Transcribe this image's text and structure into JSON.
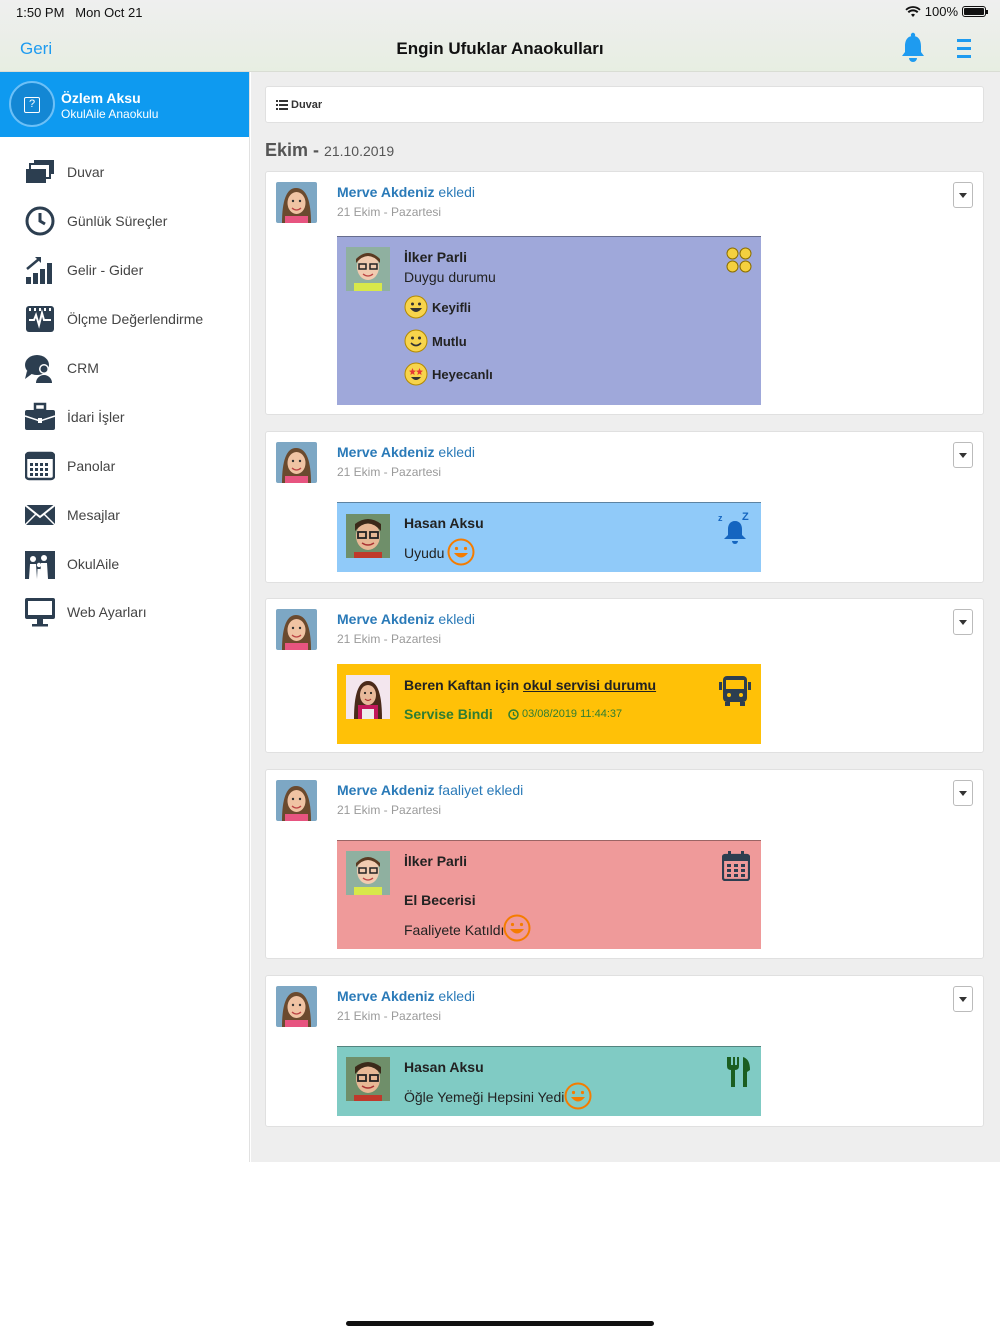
{
  "status_bar": {
    "time": "1:50 PM",
    "date": "Mon Oct 21",
    "battery": "100%"
  },
  "header": {
    "back_label": "Geri",
    "title": "Engin Ufuklar Anaokulları"
  },
  "profile": {
    "name": "Özlem Aksu",
    "school": "OkulAile Anaokulu"
  },
  "sidebar": {
    "items": [
      {
        "label": "Duvar",
        "icon": "wall-icon"
      },
      {
        "label": "Günlük Süreçler",
        "icon": "clock-icon"
      },
      {
        "label": "Gelir - Gider",
        "icon": "chart-icon"
      },
      {
        "label": "Ölçme Değerlendirme",
        "icon": "pulse-icon"
      },
      {
        "label": "CRM",
        "icon": "crm-icon"
      },
      {
        "label": "İdari İşler",
        "icon": "briefcase-icon"
      },
      {
        "label": "Panolar",
        "icon": "board-icon"
      },
      {
        "label": "Mesajlar",
        "icon": "envelope-icon"
      },
      {
        "label": "OkulAile",
        "icon": "family-icon"
      },
      {
        "label": "Web Ayarları",
        "icon": "monitor-icon"
      }
    ]
  },
  "breadcrumb": {
    "label": "Duvar"
  },
  "date_header": {
    "month": "Ekim",
    "sep": " - ",
    "date": "21.10.2019"
  },
  "posts": [
    {
      "author": "Merve Akdeniz",
      "action": " ekledi",
      "date": "21 Ekim - Pazartesi",
      "child": "İlker Parli",
      "subtitle": "Duygu durumu",
      "moods": [
        "Keyifli",
        "Mutlu",
        "Heyecanlı"
      ],
      "color": "#9fa8da"
    },
    {
      "author": "Merve Akdeniz",
      "action": " ekledi",
      "date": "21 Ekim - Pazartesi",
      "child": "Hasan Aksu",
      "status": "Uyudu",
      "color": "#90caf9"
    },
    {
      "author": "Merve Akdeniz",
      "action": " ekledi",
      "date": "21 Ekim - Pazartesi",
      "child_prefix": "Beren Kaftan için ",
      "link": "okul servisi durumu",
      "status": "Servise Bindi",
      "timestamp": "03/08/2019 11:44:37",
      "color": "#ffc107"
    },
    {
      "author": "Merve Akdeniz",
      "action": " faaliyet ekledi",
      "date": "21 Ekim - Pazartesi",
      "child": "İlker Parli",
      "activity": "El Becerisi",
      "status": "Faaliyete Katıldı",
      "color": "#ef9a9a"
    },
    {
      "author": "Merve Akdeniz",
      "action": " ekledi",
      "date": "21 Ekim - Pazartesi",
      "child": "Hasan Aksu",
      "status": "Öğle Yemeği Hepsini Yedi",
      "color": "#80cbc4"
    }
  ]
}
